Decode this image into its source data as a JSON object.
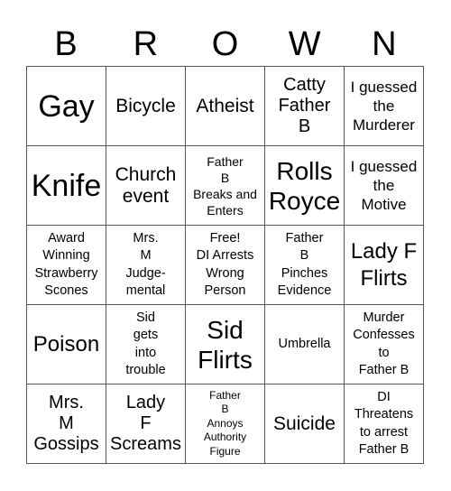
{
  "header": {
    "letters": [
      "B",
      "R",
      "O",
      "W",
      "N"
    ]
  },
  "cells": [
    [
      "Gay",
      "Bicycle",
      "Atheist",
      "Catty\nFather\nB",
      "I guessed\nthe\nMurderer"
    ],
    [
      "Knife",
      "Church\nevent",
      "Father\nB\nBreaks and\nEnters",
      "Rolls\nRoyce",
      "I guessed\nthe\nMotive"
    ],
    [
      "Award\nWinning\nStrawberry\nScones",
      "Mrs.\nM\nJudge-\nmental",
      "Free!\nDI Arrests\nWrong\nPerson",
      "Father\nB\nPinches\nEvidence",
      "Lady F\nFlirts"
    ],
    [
      "Poison",
      "Sid\ngets\ninto\ntrouble",
      "Sid\nFlirts",
      "Umbrella",
      "Murder\nConfesses\nto\nFather B"
    ],
    [
      "Mrs.\nM\nGossips",
      "Lady\nF\nScreams",
      "Father\nB\nAnnoys\nAuthority\nFigure",
      "Suicide",
      "DI\nThreatens\nto arrest\nFather B"
    ]
  ]
}
